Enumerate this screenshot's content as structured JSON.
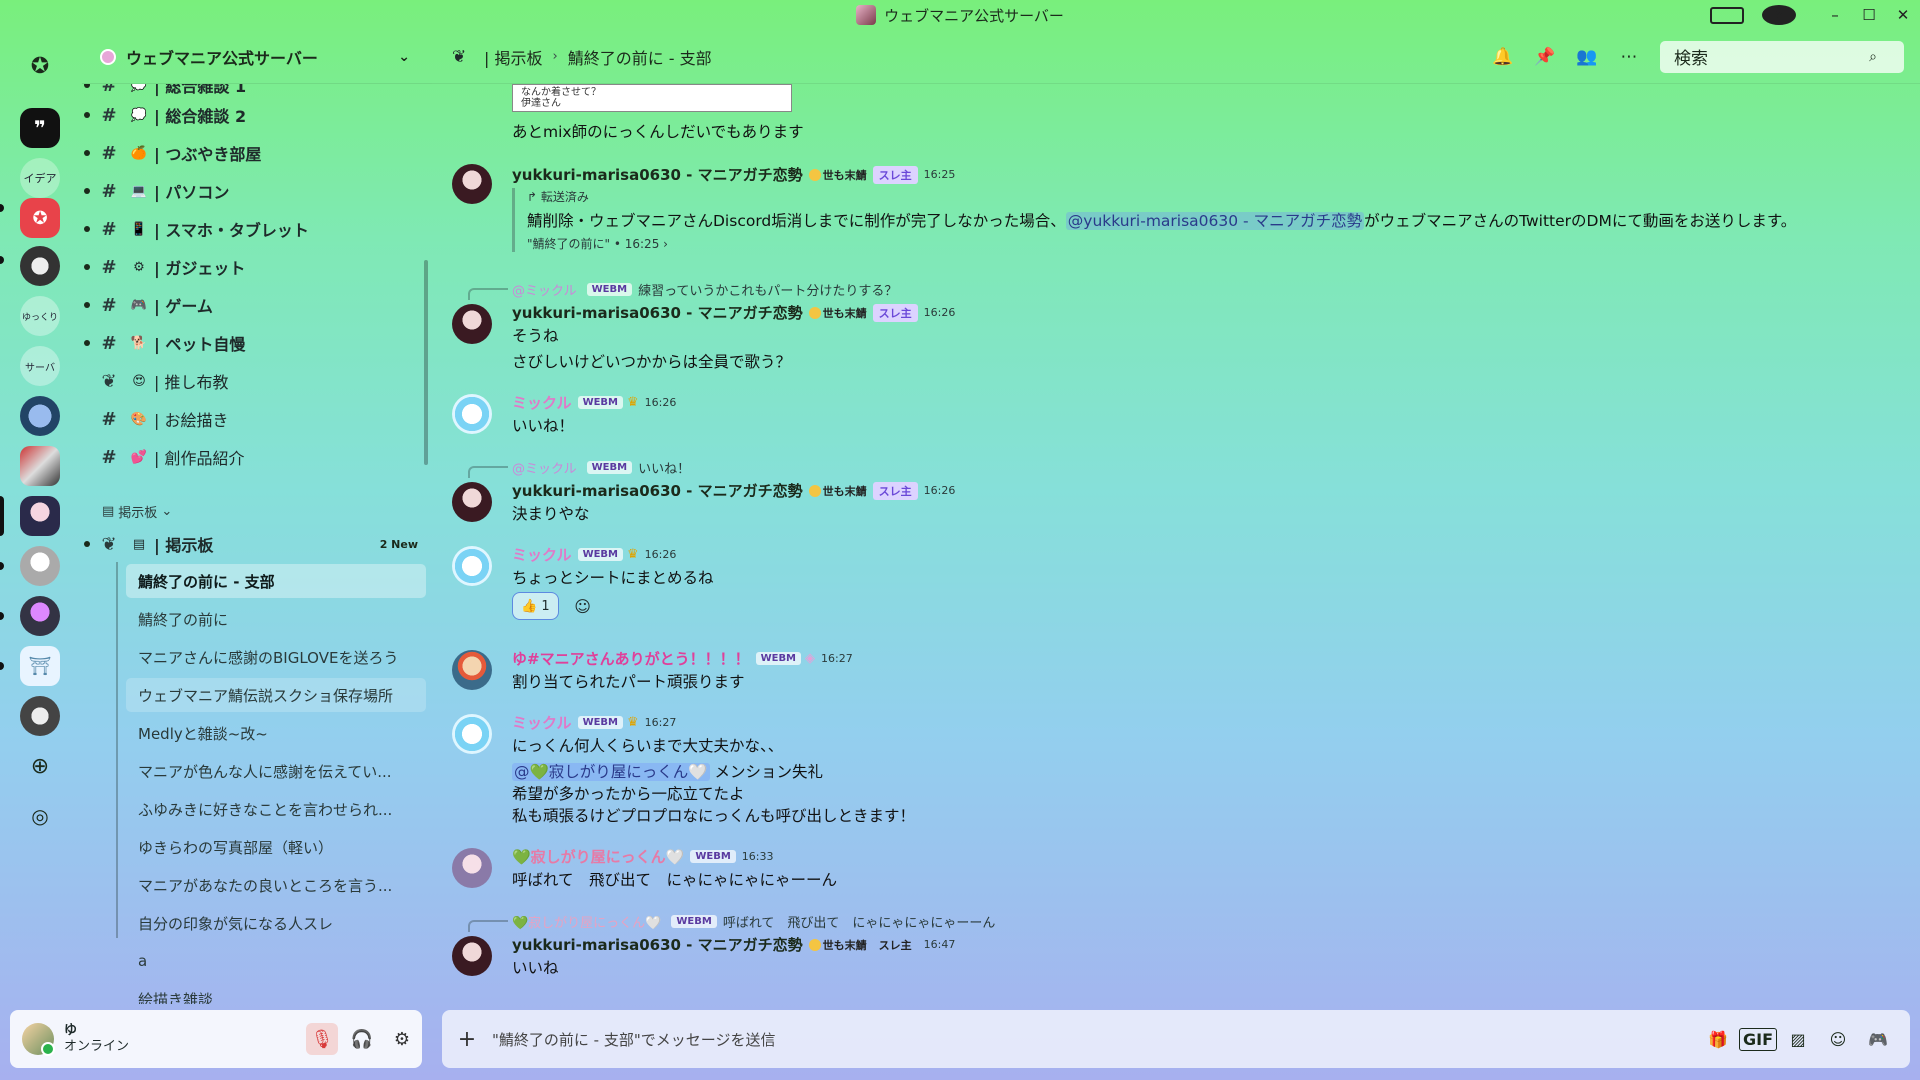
{
  "window": {
    "title": "ウェブマニア公式サーバー"
  },
  "server": {
    "name": "ウェブマニア公式サーバー"
  },
  "rail": [
    {
      "name": "home",
      "label": ""
    },
    {
      "name": "quote",
      "label": "99"
    },
    {
      "name": "idea",
      "label": "イデア"
    },
    {
      "name": "discord",
      "label": ""
    },
    {
      "name": "s5",
      "label": ""
    },
    {
      "name": "s6",
      "label": "ゆっくり"
    },
    {
      "name": "s7",
      "label": "サーバ"
    },
    {
      "name": "s8",
      "label": ""
    },
    {
      "name": "s9",
      "label": ""
    },
    {
      "name": "s10",
      "label": ""
    },
    {
      "name": "s11",
      "label": ""
    },
    {
      "name": "s12",
      "label": ""
    },
    {
      "name": "s13",
      "label": ""
    },
    {
      "name": "s14",
      "label": ""
    }
  ],
  "channels": [
    {
      "emoji": "💭",
      "label": "| 総合雑談 1"
    },
    {
      "emoji": "💭",
      "label": "| 総合雑談 2"
    },
    {
      "emoji": "🍊",
      "label": "| つぶやき部屋"
    },
    {
      "emoji": "💻",
      "label": "| パソコン"
    },
    {
      "emoji": "📱",
      "label": "| スマホ・タブレット"
    },
    {
      "emoji": "⚙",
      "label": "| ガジェット"
    },
    {
      "emoji": "🎮",
      "label": "| ゲーム"
    },
    {
      "emoji": "🐕",
      "label": "| ペット自慢"
    },
    {
      "emoji": "😍",
      "label": "| 推し布教"
    },
    {
      "emoji": "🎨",
      "label": "| お絵描き"
    },
    {
      "emoji": "💕",
      "label": "| 創作品紹介"
    }
  ],
  "category": {
    "label": "掲示板"
  },
  "forum": {
    "label": "| 掲示板",
    "new": "2 New"
  },
  "threads": [
    "鯖終了の前に - 支部",
    "鯖終了の前に",
    "マニアさんに感謝のBIGLOVEを送ろう",
    "ウェブマニア鯖伝説スクショ保存場所",
    "Medlyと雑談~改~",
    "マニアが色んな人に感謝を伝えてい...",
    "ふゆみきに好きなことを言わせられ...",
    "ゆきらわの写真部屋（軽い）",
    "マニアがあなたの良いところを言う...",
    "自分の印象が気になる人スレ",
    "a",
    "絵描き雑談"
  ],
  "user": {
    "name": "ゆ",
    "status": "オンライン"
  },
  "topbar": {
    "forum": "| 掲示板",
    "thread": "鯖終了の前に - 支部",
    "search_placeholder": "検索"
  },
  "messages": {
    "img_preview": "なんか着させて？\n伊達さん",
    "m0_text": "あとmix師のにっくんしだいでもあります",
    "marisa_name": "yukkuri-marisa0630 - マニアガチ恋勢",
    "marisa_tag": "世も末鯖",
    "op_badge": "スレ主",
    "m1_time": "16:25",
    "m1_fwd_label": "↱ 転送済み",
    "m1_fwd_pre": "鯖削除・ウェブマニアさんDiscord垢消しまでに制作が完了しなかった場合、",
    "m1_fwd_mention": "@yukkuri-marisa0630 - マニアガチ恋勢",
    "m1_fwd_post": "がウェブマニアさんのTwitterのDMにて動画をお送りします。",
    "m1_fwd_src": "\"鯖終了の前に\" • 16:25 ›",
    "m2_reply_name": "@ミックル",
    "m2_reply_text": "練習っていうかこれもパート分けたりする？",
    "m2_time": "16:26",
    "m2_l1": "そうね",
    "m2_l2": "さびしいけどいつかからは全員で歌う？",
    "miku_name": "ミックル",
    "webm": "WEBM",
    "m3_time": "16:26",
    "m3_l1": "いいね！",
    "m4_reply_text": "いいね！",
    "m4_time": "16:26",
    "m4_l1": "決まりやな",
    "m5_time": "16:26",
    "m5_l1": "ちょっとシートにまとめるね",
    "m5_react": "👍 1",
    "yu_name": "ゆ#マニアさんありがとう！！！！",
    "m6_time": "16:27",
    "m6_l1": "割り当てられたパート頑張ります",
    "m7_time": "16:27",
    "m7_l1": "にっくん何人くらいまで大丈夫かな、、",
    "m7_mention": "@💚寂しがり屋にっくん🤍",
    "m7_l2_post": " メンション失礼",
    "m7_l3": "希望が多かったから一応立てたよ",
    "m7_l4": "私も頑張るけどプロプロなにっくんも呼び出しときます！",
    "nik_name": "💚寂しがり屋にっくん🤍",
    "m8_time": "16:33",
    "m8_l1": "呼ばれて　飛び出て　にゃにゃにゃにゃーーん",
    "m9_reply_name": "💚寂しがり屋にっくん🤍",
    "m9_reply_text": "呼ばれて　飛び出て　にゃにゃにゃにゃーーん",
    "m9_time": "16:47",
    "m9_l1": "いいね"
  },
  "composer": {
    "placeholder": "\"鯖終了の前に - 支部\"でメッセージを送信",
    "gif": "GIF"
  }
}
